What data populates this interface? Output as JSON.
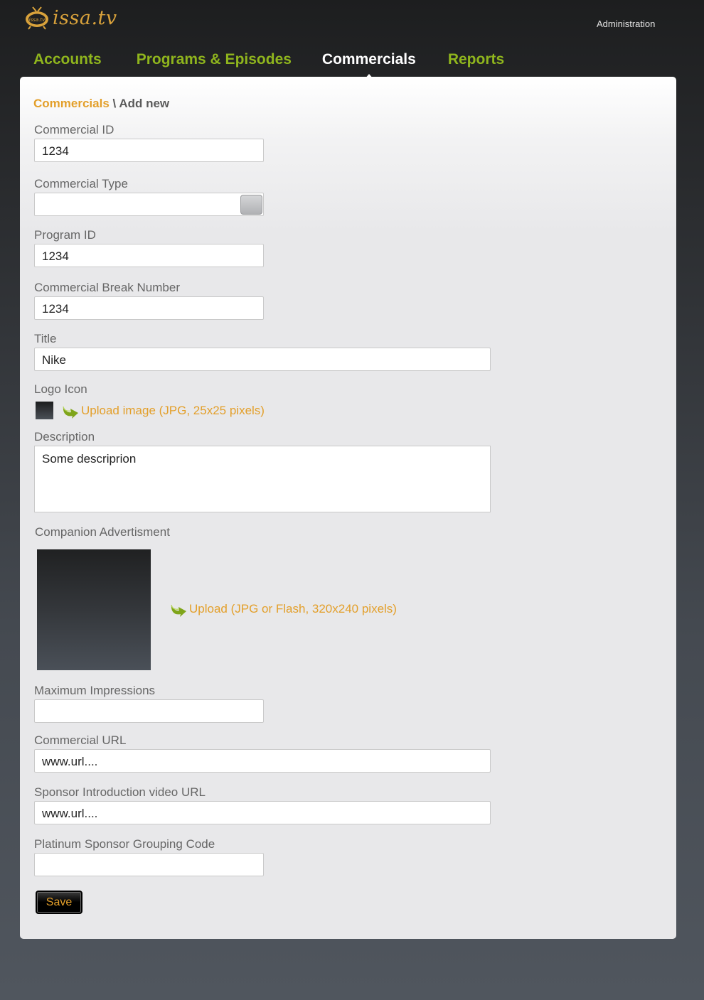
{
  "header": {
    "logo_text": "issa.tv",
    "admin_link": "Administration"
  },
  "nav": {
    "items": [
      {
        "label": "Accounts"
      },
      {
        "label": "Programs & Episodes"
      },
      {
        "label": "Commercials"
      },
      {
        "label": "Reports"
      }
    ],
    "active": "Commercials"
  },
  "breadcrumb": {
    "section": "Commercials",
    "separator": " \\ ",
    "page": "Add new"
  },
  "form": {
    "commercial_id": {
      "label": "Commercial ID",
      "value": "1234"
    },
    "commercial_type": {
      "label": "Commercial Type",
      "value": ""
    },
    "program_id": {
      "label": "Program ID",
      "value": "1234"
    },
    "break_number": {
      "label": "Commercial Break Number",
      "value": "1234"
    },
    "title": {
      "label": "Title",
      "value": "Nike"
    },
    "logo_icon": {
      "label": "Logo Icon",
      "upload_label": "Upload image (JPG, 25x25 pixels)"
    },
    "description": {
      "label": "Description",
      "value": "Some descriprion"
    },
    "companion": {
      "label": "Companion Advertisment",
      "upload_label": "Upload (JPG or Flash, 320x240 pixels)"
    },
    "max_impressions": {
      "label": "Maximum Impressions",
      "value": ""
    },
    "commercial_url": {
      "label": "Commercial URL",
      "value": "www.url...."
    },
    "sponsor_video_url": {
      "label": "Sponsor Introduction video URL",
      "value": "www.url...."
    },
    "platinum_code": {
      "label": "Platinum Sponsor Grouping Code",
      "value": ""
    },
    "save_label": "Save"
  },
  "colors": {
    "accent_orange": "#e39f2a",
    "nav_green": "#8fb51d",
    "upload_arrow_green": "#7fa51a"
  }
}
